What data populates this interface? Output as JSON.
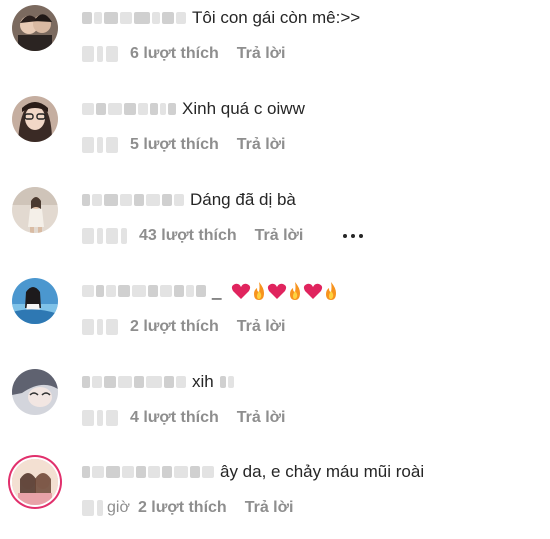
{
  "comments": [
    {
      "text": "Tôi con gái còn mê:>>",
      "likes": "6 lượt thích",
      "reply": "Trả lời",
      "avatar_colors": [
        "#6b5a4f",
        "#2b2422"
      ]
    },
    {
      "text": "Xinh quá c oiww",
      "likes": "5 lượt thích",
      "reply": "Trả lời",
      "avatar_colors": [
        "#b89a8a",
        "#3a2a25"
      ]
    },
    {
      "text": "Dáng đã dị bà",
      "likes": "43 lượt thích",
      "reply": "Trả lời",
      "avatar_colors": [
        "#d9cfc6",
        "#8a7d70"
      ]
    },
    {
      "text": "_",
      "likes": "2 lượt thích",
      "reply": "Trả lời",
      "avatar_colors": [
        "#5fa6d9",
        "#1e4f7a"
      ]
    },
    {
      "text": "xih",
      "likes": "4 lượt thích",
      "reply": "Trả lời",
      "avatar_colors": [
        "#c9cbd3",
        "#6c6f7d"
      ]
    },
    {
      "text": "ây da, e chảy máu mũi roài",
      "time_fragment": "giờ",
      "likes": "2 lượt thích",
      "reply": "Trả lời",
      "avatar_colors": [
        "#f0d9c8",
        "#b57f6a"
      ]
    }
  ],
  "emoji_sequence": [
    "heart-icon",
    "fire-icon",
    "heart-icon",
    "fire-icon",
    "heart-icon",
    "fire-icon"
  ],
  "colors": {
    "heart": "#e0245e",
    "fire": "#f7931e",
    "text": "#262626",
    "muted": "#8e8e8e"
  }
}
